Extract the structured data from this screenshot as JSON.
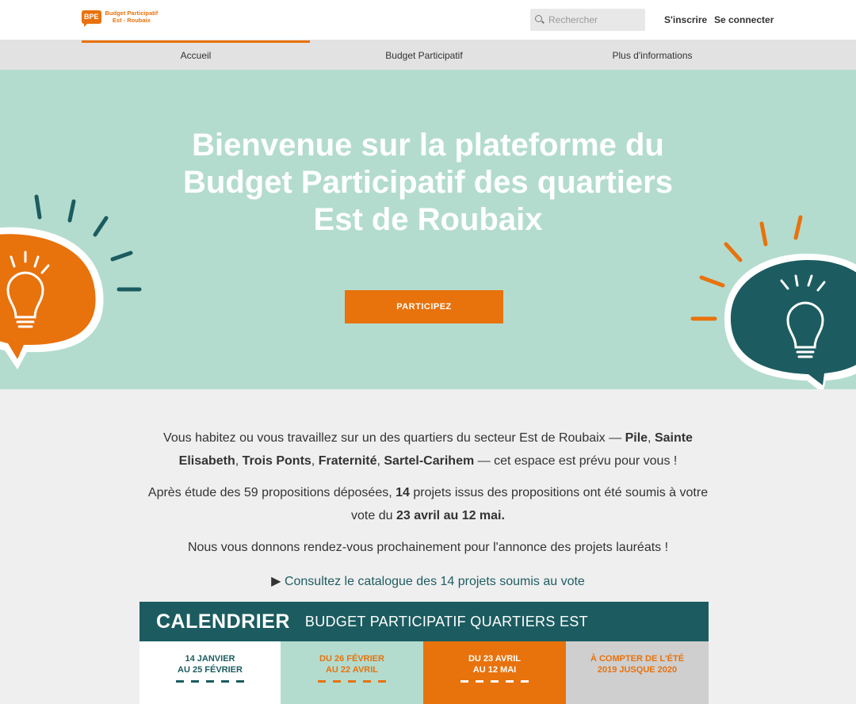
{
  "header": {
    "logo_badge": "BPE",
    "logo_line1": "Budget Participatif",
    "logo_line2": "Est - Roubaix",
    "search_placeholder": "Rechercher",
    "signup": "S'inscrire",
    "login": "Se connecter"
  },
  "nav": {
    "items": [
      {
        "label": "Accueil",
        "active": true
      },
      {
        "label": "Budget Participatif",
        "active": false
      },
      {
        "label": "Plus d'informations",
        "active": false
      }
    ]
  },
  "hero": {
    "title_line1": "Bienvenue sur la plateforme du",
    "title_line2": "Budget Participatif des quartiers",
    "title_line3": "Est de Roubaix",
    "cta": "PARTICIPEZ",
    "colors": {
      "background": "#b3dccf",
      "orange": "#e8720c",
      "teal": "#1c5c60"
    }
  },
  "content": {
    "p1_a": "Vous habitez ou vous travaillez sur un des quartiers du secteur Est de Roubaix — ",
    "p1_b": "Pile",
    "p1_c": ", ",
    "p1_d": "Sainte Elisabeth",
    "p1_e": ", ",
    "p1_f": "Trois Ponts",
    "p1_g": ", ",
    "p1_h": "Fraternité",
    "p1_i": ", ",
    "p1_j": "Sartel-Carihem",
    "p1_k": " — cet espace est prévu pour vous !",
    "p2_a": "Après étude des 59 propositions déposées, ",
    "p2_b": "14",
    "p2_c": " projets issus des propositions ont été soumis à votre vote du ",
    "p2_d": "23 avril au 12 mai.",
    "p3": "Nous vous donnons rendez-vous prochainement pour l'annonce des projets lauréats !",
    "catalog_arrow": "▶",
    "catalog_link": "Consultez le catalogue des 14 projets soumis au vote"
  },
  "calendar": {
    "title": "CALENDRIER",
    "subtitle": "BUDGET PARTICIPATIF QUARTIERS EST",
    "steps": [
      {
        "line1": "14 JANVIER",
        "line2": "AU 25 FÉVRIER",
        "bg": "#ffffff",
        "color": "#1c5c60"
      },
      {
        "line1": "DU 26 FÉVRIER",
        "line2": "AU 22 AVRIL",
        "bg": "#b3dccf",
        "color": "#e8720c"
      },
      {
        "line1": "DU 23 AVRIL",
        "line2": "AU 12 MAI",
        "bg": "#e8720c",
        "color": "#ffffff"
      },
      {
        "line1": "À COMPTER DE L'ÉTÉ",
        "line2": "2019 JUSQUE 2020",
        "bg": "#cfcfcf",
        "color": "#e8720c"
      }
    ]
  }
}
